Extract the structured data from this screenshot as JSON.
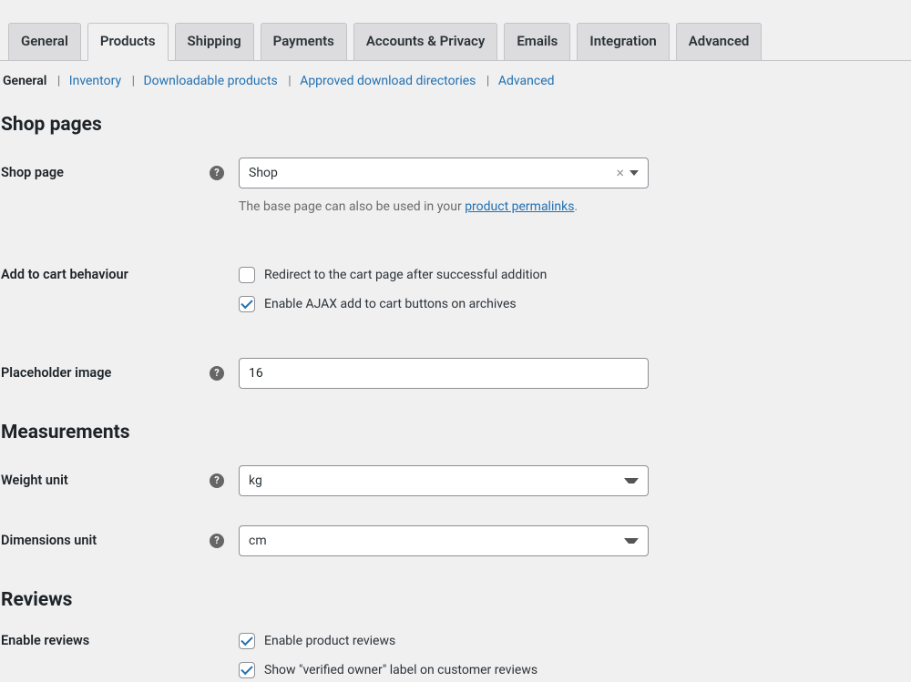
{
  "tabs": {
    "general": "General",
    "products": "Products",
    "shipping": "Shipping",
    "payments": "Payments",
    "accounts": "Accounts & Privacy",
    "emails": "Emails",
    "integration": "Integration",
    "advanced": "Advanced"
  },
  "subnav": {
    "general": "General",
    "inventory": "Inventory",
    "downloadable": "Downloadable products",
    "approved": "Approved download directories",
    "advanced": "Advanced"
  },
  "sections": {
    "shop_pages": "Shop pages",
    "measurements": "Measurements",
    "reviews": "Reviews"
  },
  "shop_page": {
    "label": "Shop page",
    "value": "Shop",
    "help_prefix": "The base page can also be used in your ",
    "help_link": "product permalinks",
    "help_suffix": "."
  },
  "add_to_cart": {
    "label": "Add to cart behaviour",
    "redirect": "Redirect to the cart page after successful addition",
    "ajax": "Enable AJAX add to cart buttons on archives"
  },
  "placeholder": {
    "label": "Placeholder image",
    "value": "16"
  },
  "weight": {
    "label": "Weight unit",
    "value": "kg"
  },
  "dimensions": {
    "label": "Dimensions unit",
    "value": "cm"
  },
  "reviews": {
    "label": "Enable reviews",
    "enable": "Enable product reviews",
    "verified": "Show \"verified owner\" label on customer reviews"
  }
}
